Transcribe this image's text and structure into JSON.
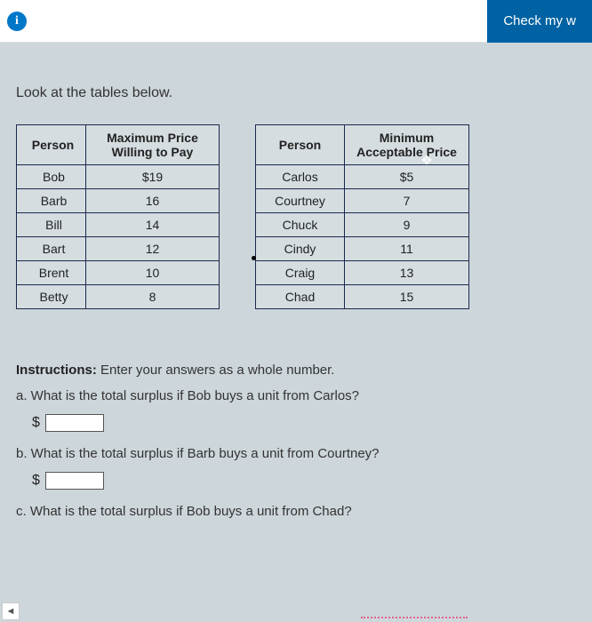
{
  "toolbar": {
    "check_label": "Check my w"
  },
  "intro": "Look at the tables below.",
  "table1": {
    "head1": "Person",
    "head2": "Maximum Price Willing to Pay",
    "rows": [
      {
        "name": "Bob",
        "val": "$19"
      },
      {
        "name": "Barb",
        "val": "16"
      },
      {
        "name": "Bill",
        "val": "14"
      },
      {
        "name": "Bart",
        "val": "12"
      },
      {
        "name": "Brent",
        "val": "10"
      },
      {
        "name": "Betty",
        "val": "8"
      }
    ]
  },
  "table2": {
    "head1": "Person",
    "head2": "Minimum Acceptable Price",
    "rows": [
      {
        "name": "Carlos",
        "val": "$5"
      },
      {
        "name": "Courtney",
        "val": "7"
      },
      {
        "name": "Chuck",
        "val": "9"
      },
      {
        "name": "Cindy",
        "val": "11"
      },
      {
        "name": "Craig",
        "val": "13"
      },
      {
        "name": "Chad",
        "val": "15"
      }
    ]
  },
  "instructions_label": "Instructions:",
  "instructions_text": " Enter your answers as a whole number.",
  "questions": {
    "a": "a. What is the total surplus if Bob buys a unit from Carlos?",
    "b": "b. What is the total surplus if Barb buys a unit from Courtney?",
    "c": "c. What is the total surplus if Bob buys a unit from Chad?"
  },
  "dollar_sign": "$"
}
